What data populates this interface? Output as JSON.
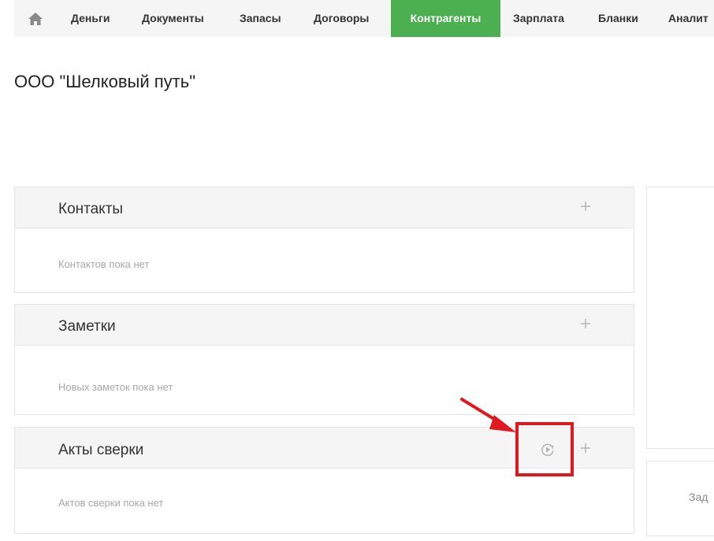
{
  "topnav": {
    "home_icon": "home-icon",
    "items": [
      {
        "label": "Деньги",
        "active": false
      },
      {
        "label": "Документы",
        "active": false
      },
      {
        "label": "Запасы",
        "active": false
      },
      {
        "label": "Договоры",
        "active": false
      },
      {
        "label": "Контрагенты",
        "active": true
      },
      {
        "label": "Зарплата",
        "active": false
      },
      {
        "label": "Бланки",
        "active": false
      },
      {
        "label": "Аналит",
        "active": false
      }
    ],
    "active_color": "#4caf50"
  },
  "page": {
    "title": "ООО \"Шелковый путь\""
  },
  "panels": {
    "contacts": {
      "title": "Контакты",
      "empty_text": "Контактов пока нет",
      "add_icon": "plus-icon"
    },
    "notes": {
      "title": "Заметки",
      "empty_text": "Новых заметок пока нет",
      "add_icon": "plus-icon"
    },
    "acts": {
      "title": "Акты сверки",
      "empty_text": "Актов сверки пока нет",
      "add_icon": "plus-icon",
      "extra_icon": "replay-icon"
    }
  },
  "right_cards": {
    "second": {
      "text": "Зад"
    }
  },
  "annotation": {
    "color": "#e0191e",
    "arrow_icon": "red-arrow-icon"
  }
}
